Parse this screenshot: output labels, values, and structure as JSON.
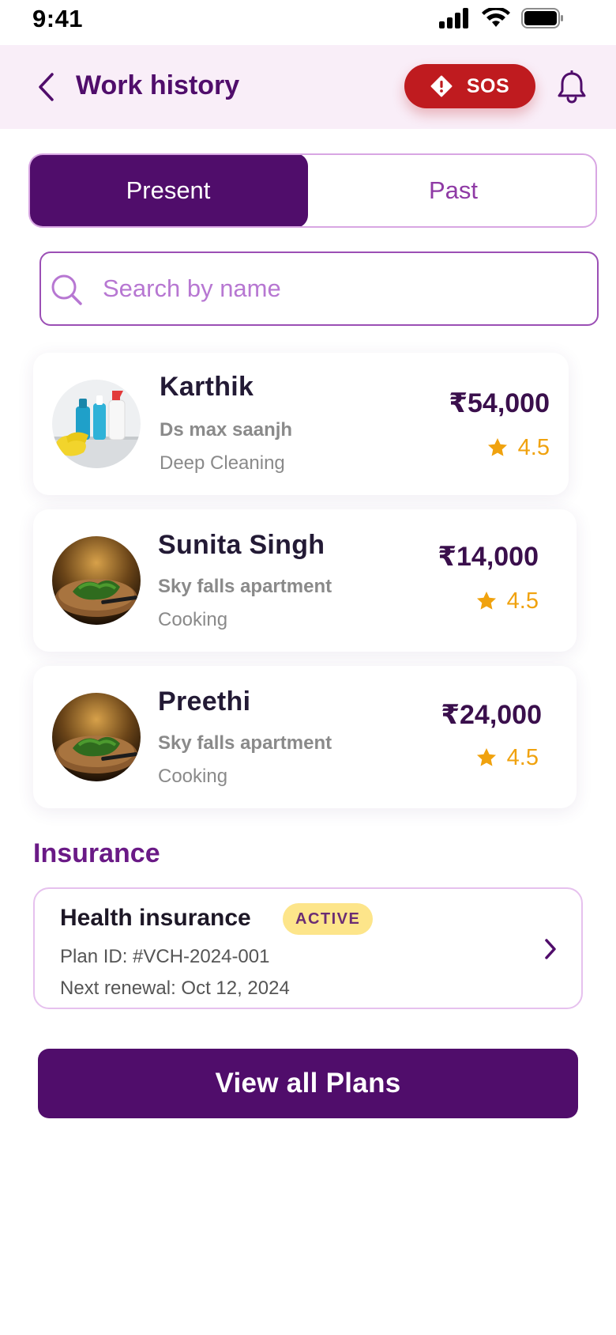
{
  "status_bar": {
    "time": "9:41"
  },
  "header": {
    "title": "Work history",
    "sos_label": "SOS"
  },
  "tabs": [
    {
      "label": "Present",
      "active": true
    },
    {
      "label": "Past",
      "active": false
    }
  ],
  "search": {
    "placeholder": "Search by name"
  },
  "workers": [
    {
      "name": "Karthik",
      "location": "Ds max saanjh",
      "service": "Deep Cleaning",
      "price": "₹54,000",
      "rating": "4.5",
      "image": "cleaning-supplies"
    },
    {
      "name": "Sunita Singh",
      "location": "Sky falls apartment",
      "service": "Cooking",
      "price": "₹14,000",
      "rating": "4.5",
      "image": "chopped-herbs"
    },
    {
      "name": "Preethi",
      "location": "Sky falls apartment",
      "service": "Cooking",
      "price": "₹24,000",
      "rating": "4.5",
      "image": "chopped-herbs"
    }
  ],
  "insurance": {
    "heading": "Insurance",
    "title": "Health insurance",
    "badge": "ACTIVE",
    "plan_id": "Plan ID: #VCH-2024-001",
    "renewal": "Next renewal: Oct 12, 2024"
  },
  "actions": {
    "view_plans_label": "View all Plans"
  },
  "colors": {
    "brand": "#500d6b",
    "sos": "#bf1b1f",
    "header_bg": "#f9eef8",
    "rating": "#f0a20e",
    "badge_bg": "#fde58a"
  },
  "icons": [
    "signal-icon",
    "wifi-icon",
    "battery-icon",
    "back-chevron-icon",
    "alert-diamond-icon",
    "bell-icon",
    "search-icon",
    "star-icon",
    "chevron-right-icon"
  ]
}
